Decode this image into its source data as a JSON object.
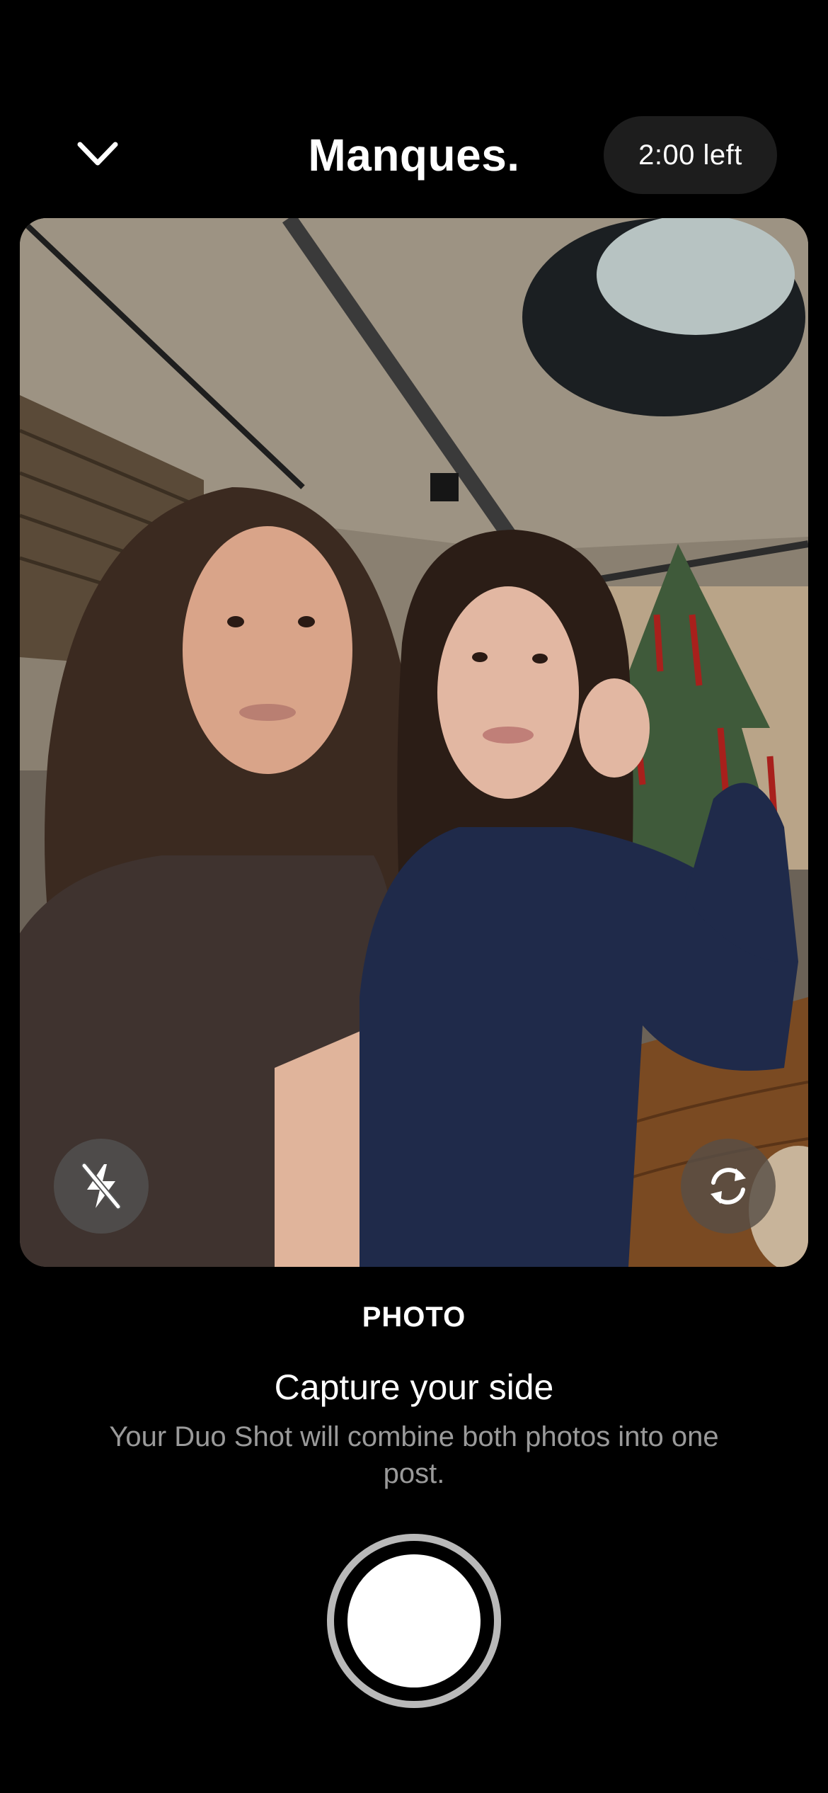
{
  "header": {
    "title": "Manques.",
    "timer": "2:00 left",
    "collapse_icon": "chevron-down-icon"
  },
  "viewfinder": {
    "flash_icon": "flash-off-icon",
    "flip_icon": "camera-flip-icon"
  },
  "mode": {
    "label": "PHOTO"
  },
  "prompt": {
    "heading": "Capture your side",
    "subtext": "Your Duo Shot will combine both photos into one post."
  },
  "shutter": {
    "icon": "shutter-button"
  },
  "colors": {
    "background": "#000000",
    "pill": "#1d1d1d",
    "muted_text": "#9a9a9a",
    "shutter_ring": "#b9b9b9"
  }
}
